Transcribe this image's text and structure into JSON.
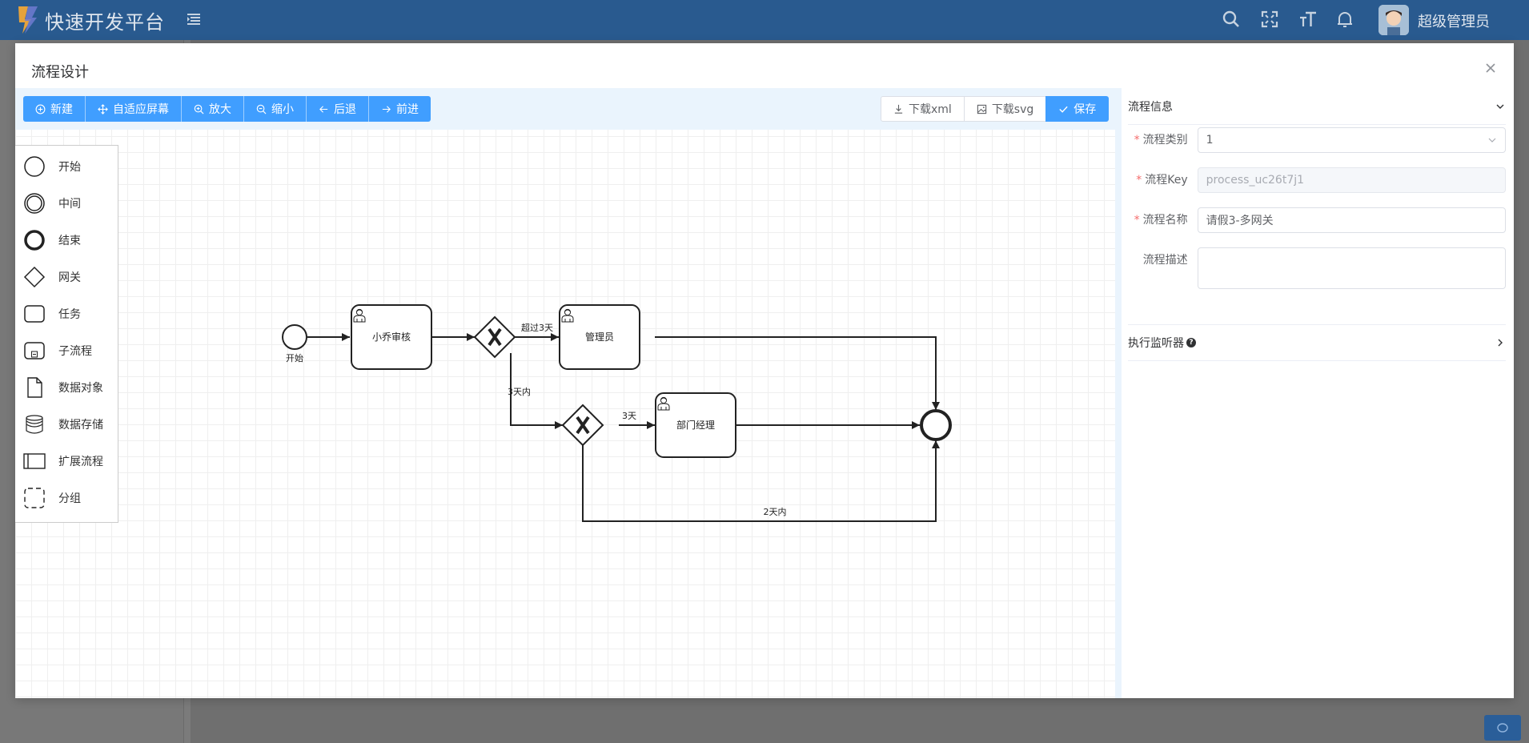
{
  "app": {
    "title": "快速开发平台",
    "user_name": "超级管理员"
  },
  "header_icons": [
    "menu-icon",
    "search-icon",
    "fullscreen-icon",
    "font-size-icon",
    "bell-icon"
  ],
  "dialog": {
    "title": "流程设计"
  },
  "toolbar": {
    "new": "新建",
    "fit": "自适应屏幕",
    "zoom_in": "放大",
    "zoom_out": "缩小",
    "undo": "后退",
    "redo": "前进",
    "download_xml": "下载xml",
    "download_svg": "下载svg",
    "save": "保存"
  },
  "palette": [
    {
      "label": "开始",
      "icon": "start-event-icon"
    },
    {
      "label": "中间",
      "icon": "intermediate-event-icon"
    },
    {
      "label": "结束",
      "icon": "end-event-icon"
    },
    {
      "label": "网关",
      "icon": "gateway-icon"
    },
    {
      "label": "任务",
      "icon": "task-icon"
    },
    {
      "label": "子流程",
      "icon": "subprocess-icon"
    },
    {
      "label": "数据对象",
      "icon": "data-object-icon"
    },
    {
      "label": "数据存储",
      "icon": "data-store-icon"
    },
    {
      "label": "扩展流程",
      "icon": "pool-icon"
    },
    {
      "label": "分组",
      "icon": "group-icon"
    }
  ],
  "diagram": {
    "start_label": "开始",
    "task1": "小乔审核",
    "task2": "管理员",
    "task3": "部门经理",
    "flow_over3": "超过3天",
    "flow_within3": "3天内",
    "flow_3days": "3天",
    "flow_within2": "2天内"
  },
  "properties": {
    "section_info": "流程信息",
    "category_label": "流程类别",
    "category_value": "1",
    "key_label": "流程Key",
    "key_value": "process_uc26t7j1",
    "name_label": "流程名称",
    "name_value": "请假3-多网关",
    "desc_label": "流程描述",
    "desc_value": "",
    "section_listener": "执行监听器"
  },
  "colors": {
    "header": "#295a8f",
    "primary": "#409eff",
    "required": "#f56c6c"
  }
}
